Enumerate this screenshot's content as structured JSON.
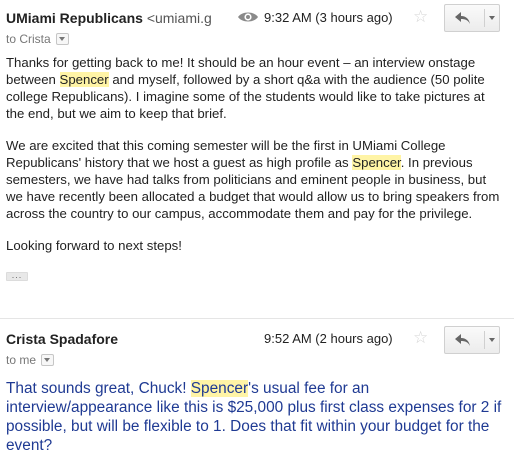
{
  "messages": [
    {
      "sender": "UMiami Republicans",
      "sender_email": "<umiami.g",
      "recipient_line": "to Crista",
      "time": "9:32 AM (3 hours ago)",
      "icons": [
        "eye-icon",
        "star-icon",
        "reply-icon",
        "more-actions-chevron-icon"
      ],
      "body": {
        "p1_a": "Thanks for getting back to me! It should be an hour event – an interview onstage between ",
        "p1_hl": "Spencer",
        "p1_b": " and myself, followed by a short q&a with the audience (50 polite college Republicans). I imagine some of the students would like to take pictures at the end, but we aim to keep that brief.",
        "p2_a": "We are excited that this coming semester will be the first in UMiami College Republicans' history that we host a guest as high profile as ",
        "p2_hl": "Spencer",
        "p2_b": ". In previous semesters, we have had talks from politicians and eminent people in business, but we have recently been allocated a budget that would allow us to bring speakers from across the country to our campus, accommodate them and pay for the privilege.",
        "p3": "Looking forward to next steps!",
        "trimmed_content": "..."
      }
    },
    {
      "sender": "Crista Spadafore",
      "recipient_line": "to me",
      "time": "9:52 AM (2 hours ago)",
      "icons": [
        "star-icon",
        "reply-icon",
        "more-actions-chevron-icon"
      ],
      "body": {
        "a": "That sounds great, Chuck! ",
        "hl": "Spencer",
        "b": "'s usual fee for an interview/appearance like this is $25,000 plus first class expenses for 2 if possible, but will be flexible to 1. Does that fit within your budget for the event?"
      }
    }
  ],
  "colors": {
    "highlight": "#fff4a6",
    "reply_text": "#1f3a93"
  }
}
